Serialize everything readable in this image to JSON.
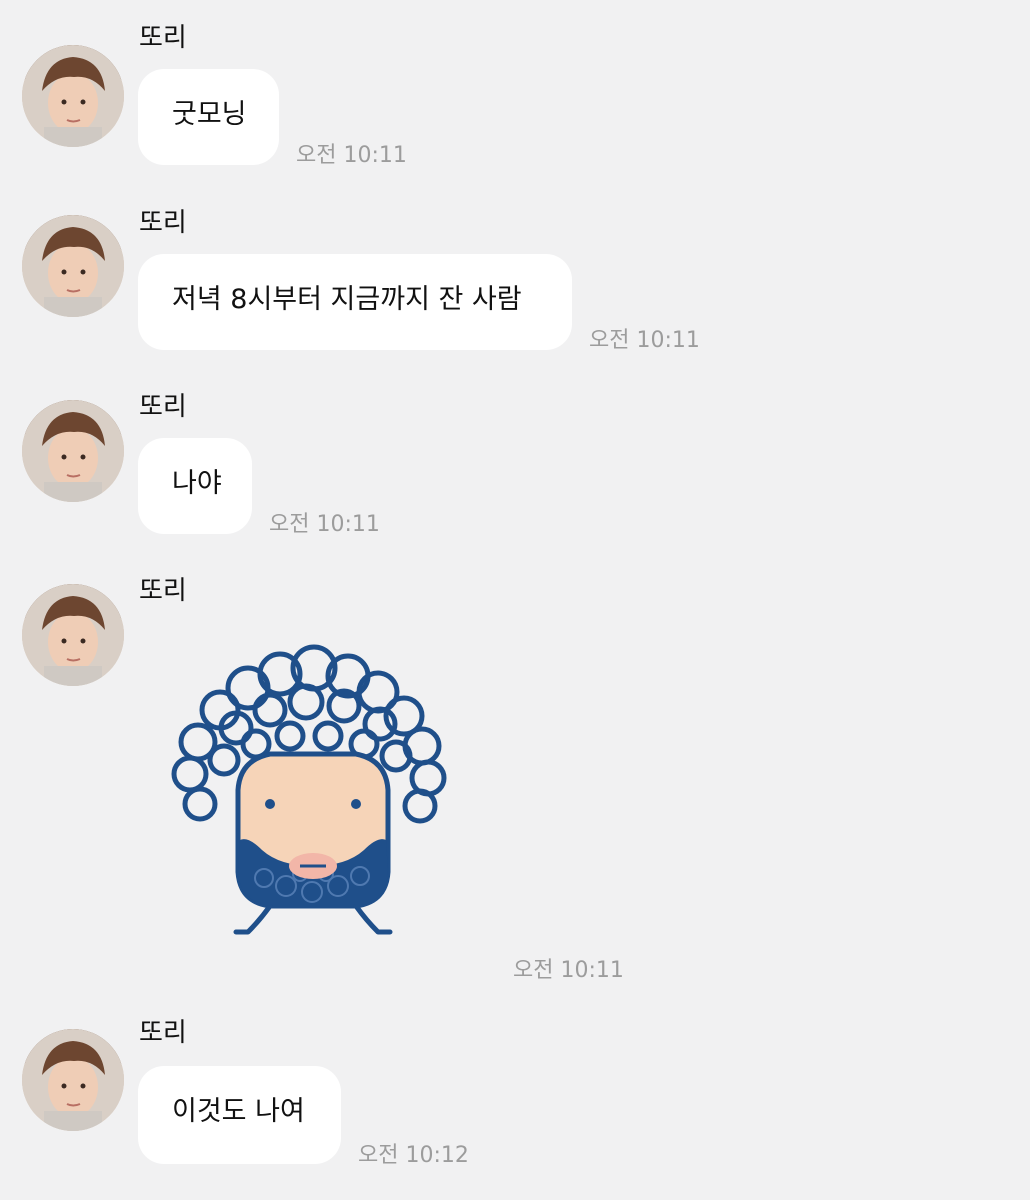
{
  "messages": [
    {
      "sender": "또리",
      "text": "굿모닝",
      "time": "오전 10:11"
    },
    {
      "sender": "또리",
      "text": "저녁 8시부터 지금까지 잔 사람",
      "time": "오전 10:11"
    },
    {
      "sender": "또리",
      "text": "나야",
      "time": "오전 10:11"
    },
    {
      "sender": "또리",
      "sticker": "curly-hair-bearded-character-sticker",
      "time": "오전 10:11"
    },
    {
      "sender": "또리",
      "text": "이것도 나여",
      "time": "오전 10:12"
    }
  ],
  "colors": {
    "background": "#f1f1f2",
    "bubble": "#ffffff",
    "time": "#9c9c9c",
    "sticker_ink": "#1f4f8a",
    "sticker_skin": "#f6d4b8"
  }
}
